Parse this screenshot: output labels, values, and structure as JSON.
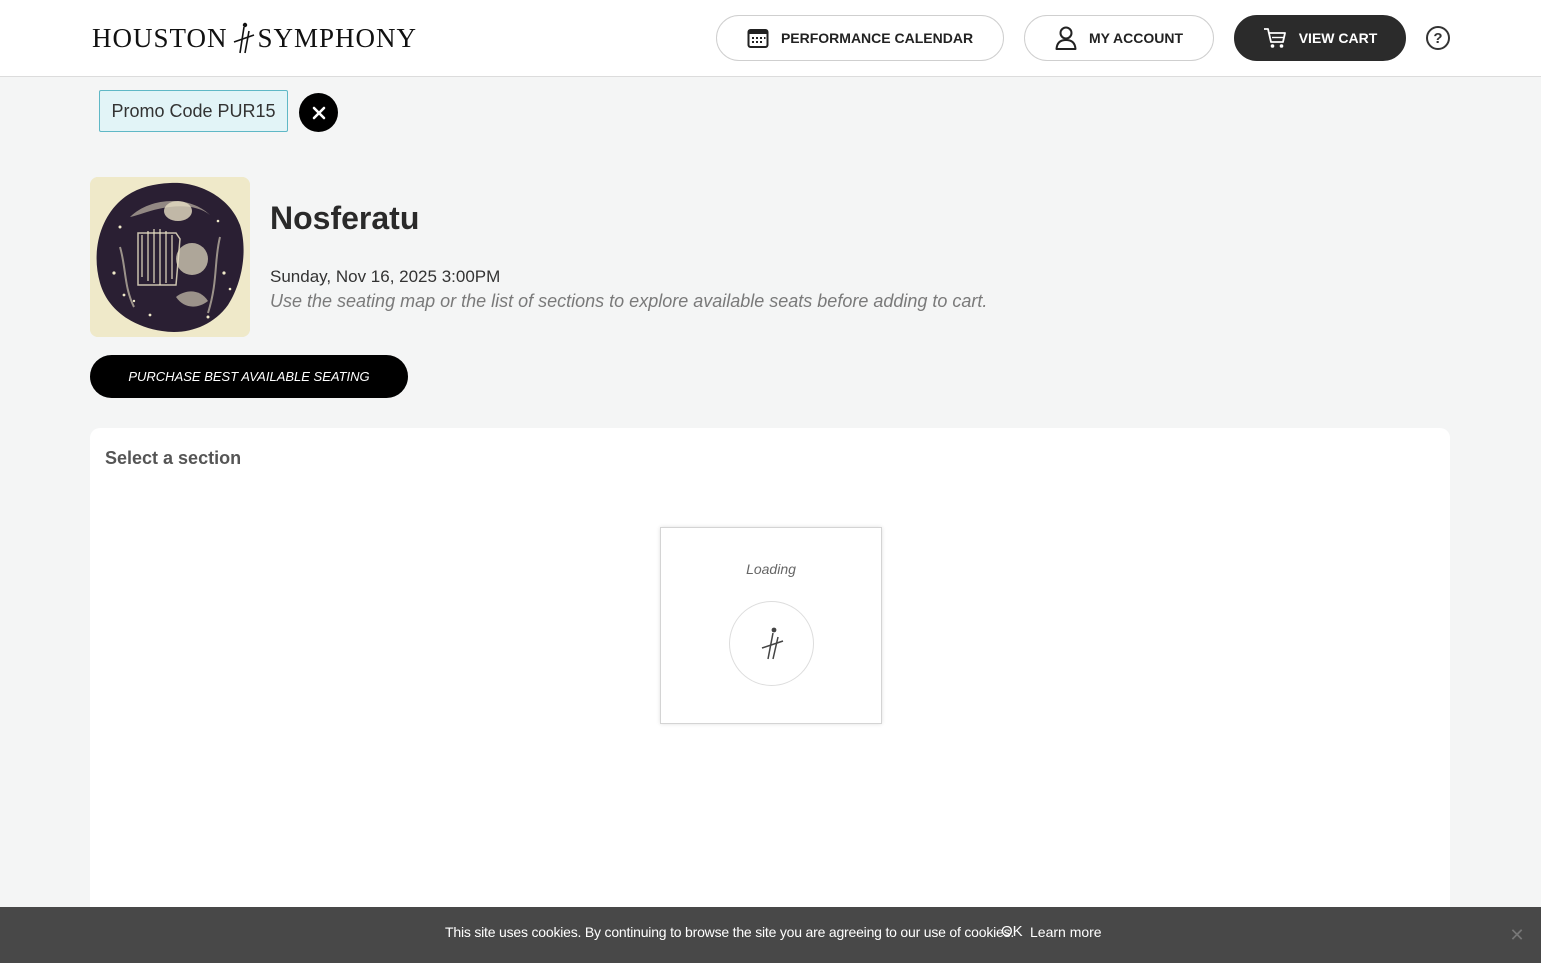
{
  "brand": {
    "logo_left": "HOUSTON",
    "logo_right": "SYMPHONY"
  },
  "header": {
    "calendar_label": "PERFORMANCE CALENDAR",
    "account_label": "MY ACCOUNT",
    "cart_label": "VIEW CART",
    "help_label": "?"
  },
  "promo": {
    "label": "Promo Code PUR15"
  },
  "event": {
    "title": "Nosferatu",
    "date": "Sunday, Nov 16, 2025 3:00PM",
    "hint": "Use the seating map or the list of sections to explore available seats before adding to cart.",
    "best_button": "PURCHASE BEST AVAILABLE SEATING"
  },
  "seating": {
    "title": "Select a section",
    "loading_text": "Loading"
  },
  "cookie": {
    "message": "This site uses cookies. By continuing to browse the site you are agreeing to our use of cookies.",
    "ok": "OK",
    "learn_more": "Learn more"
  },
  "icons": {
    "calendar": "calendar-icon",
    "account": "user-icon",
    "cart": "cart-icon",
    "help": "help-icon",
    "promo_close": "close-icon",
    "cookie_close": "close-icon"
  }
}
